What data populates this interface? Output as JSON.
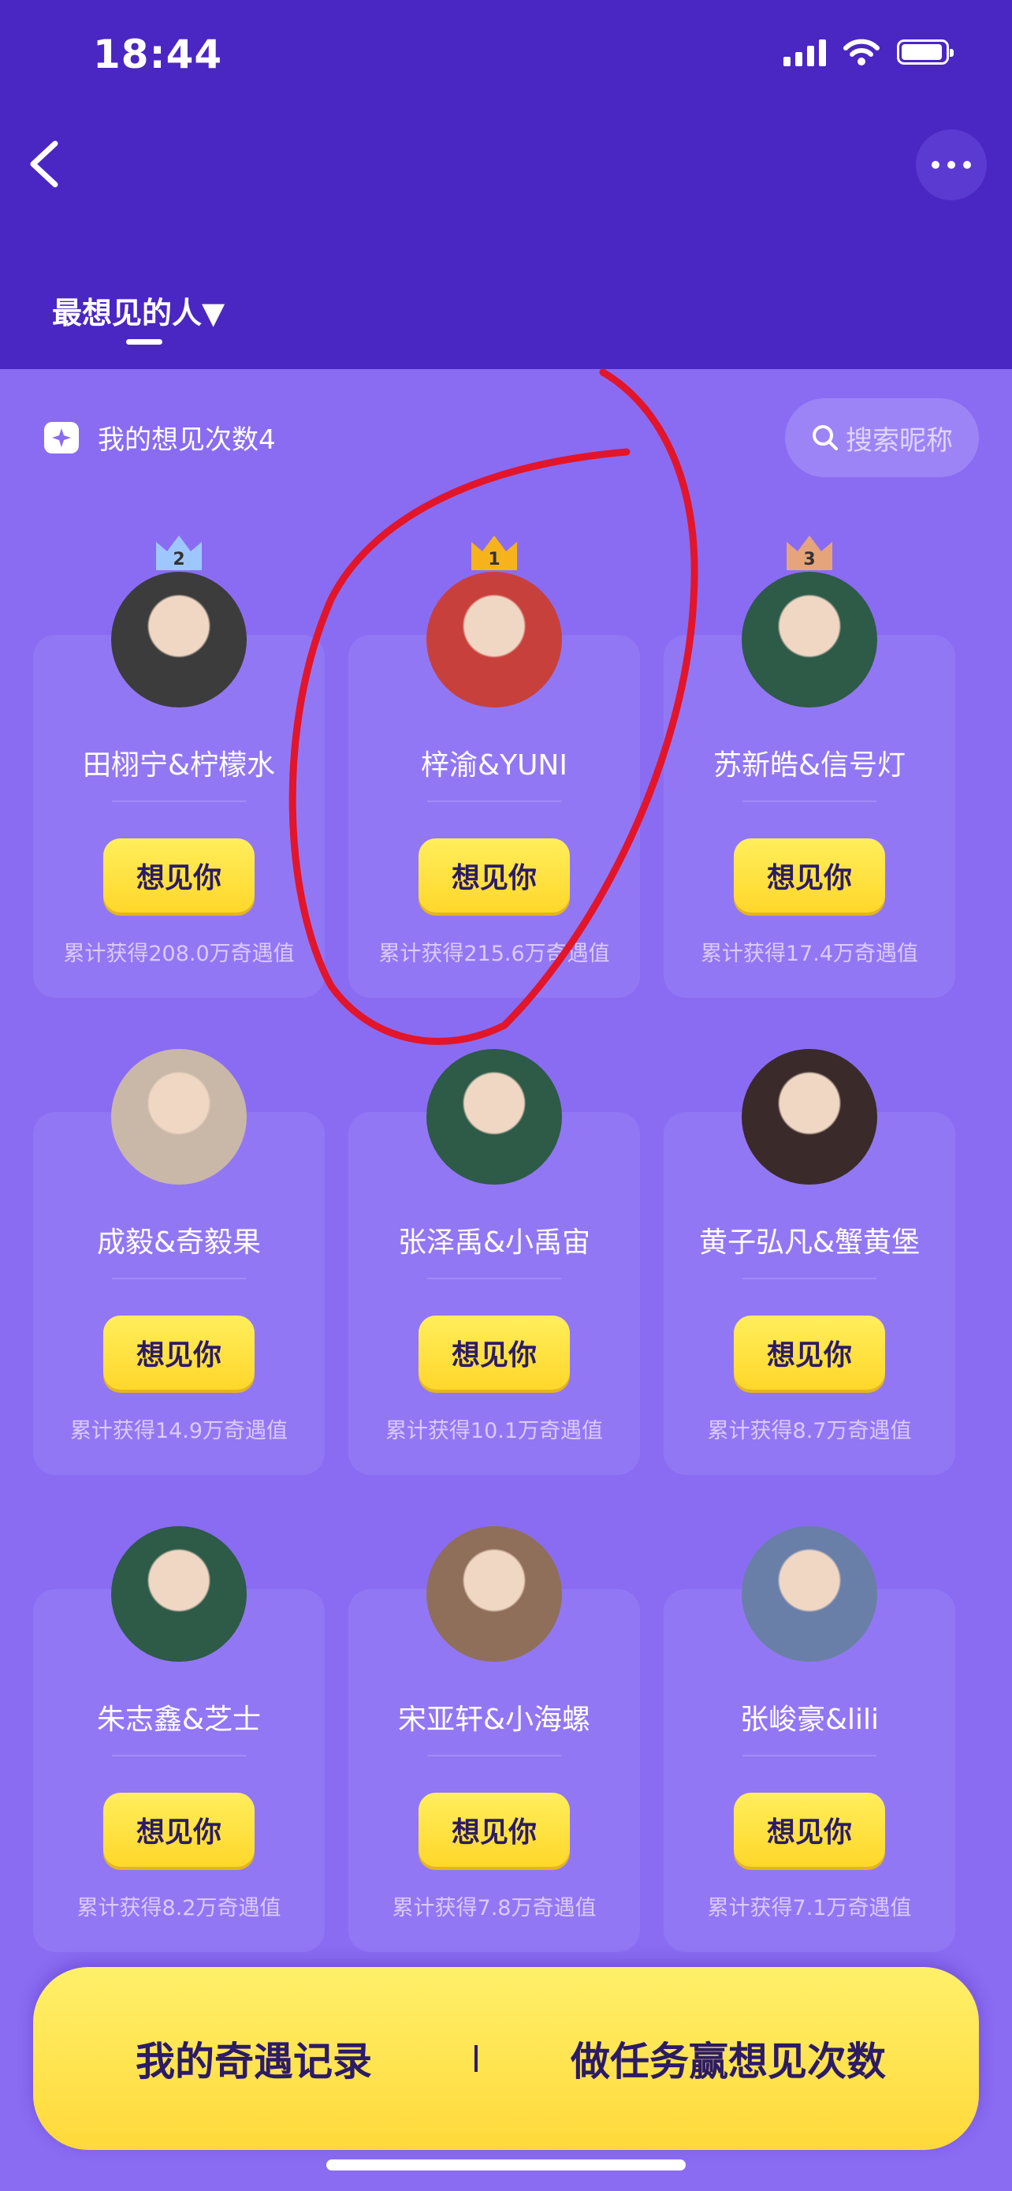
{
  "status_bar": {
    "time": "18:44"
  },
  "header": {
    "tab_label": "最想见的人▼"
  },
  "toolbar": {
    "count_label": "我的想见次数4",
    "search_placeholder": "搜索昵称"
  },
  "cards": [
    {
      "rank": "2",
      "name": "田栩宁&柠檬水",
      "button": "想见你",
      "stat": "累计获得208.0万奇遇值",
      "avatar_color": "#3c3c3c"
    },
    {
      "rank": "1",
      "name": "梓渝&YUNI",
      "button": "想见你",
      "stat": "累计获得215.6万奇遇值",
      "avatar_color": "#c8403c"
    },
    {
      "rank": "3",
      "name": "苏新皓&信号灯",
      "button": "想见你",
      "stat": "累计获得17.4万奇遇值",
      "avatar_color": "#2e5a48"
    },
    {
      "rank": "",
      "name": "成毅&奇毅果",
      "button": "想见你",
      "stat": "累计获得14.9万奇遇值",
      "avatar_color": "#c9b8a8"
    },
    {
      "rank": "",
      "name": "张泽禹&小禹宙",
      "button": "想见你",
      "stat": "累计获得10.1万奇遇值",
      "avatar_color": "#2e5a48"
    },
    {
      "rank": "",
      "name": "黄子弘凡&蟹黄堡",
      "button": "想见你",
      "stat": "累计获得8.7万奇遇值",
      "avatar_color": "#3a2a2a"
    },
    {
      "rank": "",
      "name": "朱志鑫&芝士",
      "button": "想见你",
      "stat": "累计获得8.2万奇遇值",
      "avatar_color": "#2e5a48"
    },
    {
      "rank": "",
      "name": "宋亚轩&小海螺",
      "button": "想见你",
      "stat": "累计获得7.8万奇遇值",
      "avatar_color": "#8f6f5a"
    },
    {
      "rank": "",
      "name": "张峻豪&lili",
      "button": "想见你",
      "stat": "累计获得7.1万奇遇值",
      "avatar_color": "#6a7fa8"
    }
  ],
  "bottom_bar": {
    "left_label": "我的奇遇记录",
    "right_label": "做任务赢想见次数"
  },
  "colors": {
    "header": "#4a26c2",
    "background": "#8a6cf2",
    "button_yellow": "#ffde35",
    "annotation_red": "#e2152a"
  }
}
